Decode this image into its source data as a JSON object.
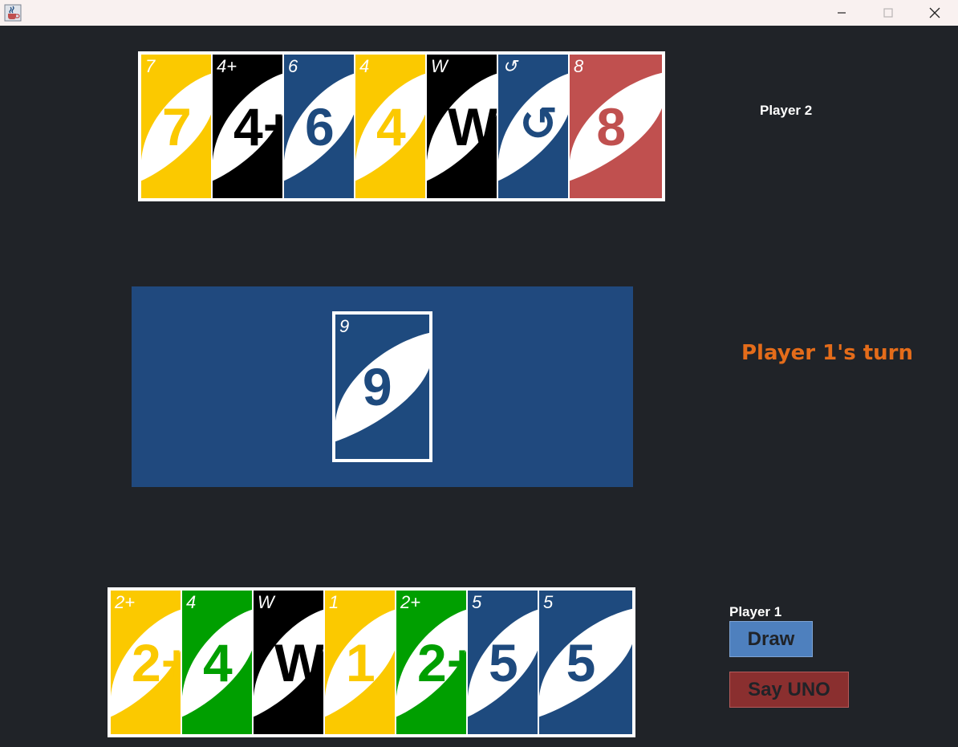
{
  "window": {
    "app_icon": "java-cup-icon",
    "controls": [
      "minimize-icon",
      "maximize-icon",
      "close-icon"
    ]
  },
  "colors": {
    "yellow": "#fbc900",
    "black": "#000000",
    "blue": "#1e4a7e",
    "red": "#c0504f",
    "green": "#009f00",
    "table": "#20497e",
    "background": "#202328",
    "turn_text": "#e46c1a",
    "draw_button": "#4e80be",
    "uno_button": "#8a2f2f"
  },
  "player2": {
    "name": "Player 2",
    "cards": [
      {
        "color": "yellow",
        "corner": "7",
        "label": "7"
      },
      {
        "color": "black",
        "corner": "4+",
        "label": "4+"
      },
      {
        "color": "blue",
        "corner": "6",
        "label": "6"
      },
      {
        "color": "yellow",
        "corner": "4",
        "label": "4"
      },
      {
        "color": "black",
        "corner": "W",
        "label": "W"
      },
      {
        "color": "blue",
        "corner": "↺",
        "label": "↺"
      },
      {
        "color": "red",
        "corner": "8",
        "label": "8"
      }
    ]
  },
  "table": {
    "top_card": {
      "color": "blue",
      "corner": "9",
      "label": "9"
    }
  },
  "status": {
    "turn_text": "Player 1's turn"
  },
  "player1": {
    "name": "Player 1",
    "cards": [
      {
        "color": "yellow",
        "corner": "2+",
        "label": "2+"
      },
      {
        "color": "green",
        "corner": "4",
        "label": "4"
      },
      {
        "color": "black",
        "corner": "W",
        "label": "W"
      },
      {
        "color": "yellow",
        "corner": "1",
        "label": "1"
      },
      {
        "color": "green",
        "corner": "2+",
        "label": "2+"
      },
      {
        "color": "blue",
        "corner": "5",
        "label": "5"
      },
      {
        "color": "blue",
        "corner": "5",
        "label": "5"
      }
    ],
    "draw_label": "Draw",
    "uno_label": "Say UNO"
  }
}
